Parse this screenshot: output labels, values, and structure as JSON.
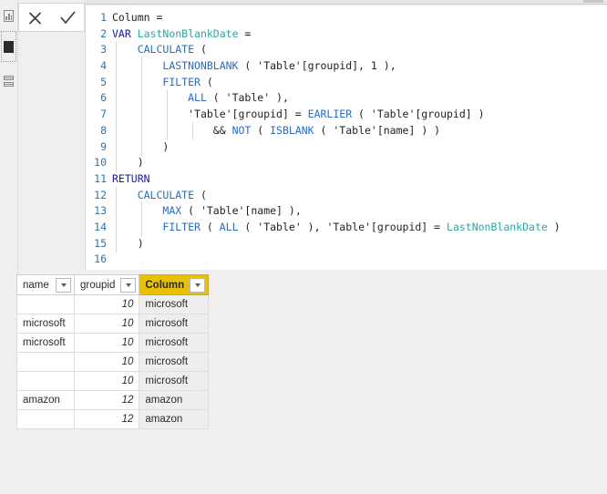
{
  "view_rail": {
    "items": [
      {
        "name": "report-view",
        "icon": "report-view-icon",
        "selected": false
      },
      {
        "name": "data-view",
        "icon": "data-view-icon",
        "selected": true
      },
      {
        "name": "model-view",
        "icon": "model-view-icon",
        "selected": false
      }
    ]
  },
  "formula_actions": {
    "cancel_label": "✕",
    "cancel_icon": "close-x-icon",
    "commit_label": "✓",
    "commit_icon": "checkmark-icon"
  },
  "editor": {
    "measure_name": "Column",
    "lines": [
      {
        "n": "1",
        "tokens": [
          {
            "t": "Column",
            "c": "ref"
          },
          {
            "t": " = ",
            "c": "op"
          }
        ],
        "guides": 0
      },
      {
        "n": "2",
        "tokens": [
          {
            "t": "VAR",
            "c": "kw"
          },
          {
            "t": " ",
            "c": "op"
          },
          {
            "t": "LastNonBlankDate",
            "c": "var"
          },
          {
            "t": " =",
            "c": "op"
          }
        ],
        "guides": 0
      },
      {
        "n": "3",
        "tokens": [
          {
            "t": "    ",
            "c": "op"
          },
          {
            "t": "CALCULATE",
            "c": "fn"
          },
          {
            "t": " (",
            "c": "op"
          }
        ],
        "guides": 1
      },
      {
        "n": "4",
        "tokens": [
          {
            "t": "        ",
            "c": "op"
          },
          {
            "t": "LASTNONBLANK",
            "c": "fn"
          },
          {
            "t": " ( ",
            "c": "op"
          },
          {
            "t": "'Table'[groupid]",
            "c": "ref"
          },
          {
            "t": ", ",
            "c": "op"
          },
          {
            "t": "1",
            "c": "num"
          },
          {
            "t": " ),",
            "c": "op"
          }
        ],
        "guides": 2
      },
      {
        "n": "5",
        "tokens": [
          {
            "t": "        ",
            "c": "op"
          },
          {
            "t": "FILTER",
            "c": "fn"
          },
          {
            "t": " (",
            "c": "op"
          }
        ],
        "guides": 2
      },
      {
        "n": "6",
        "tokens": [
          {
            "t": "            ",
            "c": "op"
          },
          {
            "t": "ALL",
            "c": "fn"
          },
          {
            "t": " ( ",
            "c": "op"
          },
          {
            "t": "'Table'",
            "c": "ref"
          },
          {
            "t": " ),",
            "c": "op"
          }
        ],
        "guides": 3
      },
      {
        "n": "7",
        "tokens": [
          {
            "t": "            ",
            "c": "op"
          },
          {
            "t": "'Table'[groupid]",
            "c": "ref"
          },
          {
            "t": " = ",
            "c": "op"
          },
          {
            "t": "EARLIER",
            "c": "fn"
          },
          {
            "t": " ( ",
            "c": "op"
          },
          {
            "t": "'Table'[groupid]",
            "c": "ref"
          },
          {
            "t": " )",
            "c": "op"
          }
        ],
        "guides": 3
      },
      {
        "n": "8",
        "tokens": [
          {
            "t": "                ",
            "c": "op"
          },
          {
            "t": "&& ",
            "c": "op"
          },
          {
            "t": "NOT",
            "c": "fn"
          },
          {
            "t": " ( ",
            "c": "op"
          },
          {
            "t": "ISBLANK",
            "c": "fn"
          },
          {
            "t": " ( ",
            "c": "op"
          },
          {
            "t": "'Table'[name]",
            "c": "ref"
          },
          {
            "t": " ) )",
            "c": "op"
          }
        ],
        "guides": 4
      },
      {
        "n": "9",
        "tokens": [
          {
            "t": "        )",
            "c": "op"
          }
        ],
        "guides": 2
      },
      {
        "n": "10",
        "tokens": [
          {
            "t": "    )",
            "c": "op"
          }
        ],
        "guides": 1
      },
      {
        "n": "11",
        "tokens": [
          {
            "t": "RETURN",
            "c": "kw"
          }
        ],
        "guides": 0
      },
      {
        "n": "12",
        "tokens": [
          {
            "t": "    ",
            "c": "op"
          },
          {
            "t": "CALCULATE",
            "c": "fn"
          },
          {
            "t": " (",
            "c": "op"
          }
        ],
        "guides": 1
      },
      {
        "n": "13",
        "tokens": [
          {
            "t": "        ",
            "c": "op"
          },
          {
            "t": "MAX",
            "c": "fn"
          },
          {
            "t": " ( ",
            "c": "op"
          },
          {
            "t": "'Table'[name]",
            "c": "ref"
          },
          {
            "t": " ),",
            "c": "op"
          }
        ],
        "guides": 2
      },
      {
        "n": "14",
        "tokens": [
          {
            "t": "        ",
            "c": "op"
          },
          {
            "t": "FILTER",
            "c": "fn"
          },
          {
            "t": " ( ",
            "c": "op"
          },
          {
            "t": "ALL",
            "c": "fn"
          },
          {
            "t": " ( ",
            "c": "op"
          },
          {
            "t": "'Table'",
            "c": "ref"
          },
          {
            "t": " ), ",
            "c": "op"
          },
          {
            "t": "'Table'[groupid]",
            "c": "ref"
          },
          {
            "t": " = ",
            "c": "op"
          },
          {
            "t": "LastNonBlankDate",
            "c": "var"
          },
          {
            "t": " )",
            "c": "op"
          }
        ],
        "guides": 2
      },
      {
        "n": "15",
        "tokens": [
          {
            "t": "    )",
            "c": "op"
          }
        ],
        "guides": 1
      },
      {
        "n": "16",
        "tokens": [
          {
            "t": "",
            "c": "op"
          }
        ],
        "guides": 0
      }
    ]
  },
  "grid": {
    "columns": [
      {
        "key": "name",
        "label": "name",
        "selected": false,
        "filter_icon": "filter-caret-icon"
      },
      {
        "key": "groupid",
        "label": "groupid",
        "selected": false,
        "filter_icon": "filter-caret-icon"
      },
      {
        "key": "column",
        "label": "Column",
        "selected": true,
        "filter_icon": "filter-caret-icon"
      }
    ],
    "rows": [
      {
        "name": "",
        "groupid": "10",
        "column": "microsoft"
      },
      {
        "name": "microsoft",
        "groupid": "10",
        "column": "microsoft"
      },
      {
        "name": "microsoft",
        "groupid": "10",
        "column": "microsoft"
      },
      {
        "name": "",
        "groupid": "10",
        "column": "microsoft"
      },
      {
        "name": "",
        "groupid": "10",
        "column": "microsoft"
      },
      {
        "name": "amazon",
        "groupid": "12",
        "column": "amazon"
      },
      {
        "name": "",
        "groupid": "12",
        "column": "amazon"
      }
    ]
  },
  "colors": {
    "selected_column_header": "#e8c107",
    "selected_column_cell": "#eeeeee",
    "keyword": "#1a1a9e",
    "function": "#2a6bc4",
    "variable": "#2ba7a0",
    "line_number": "#2e75a8",
    "app_background": "#f0efee"
  }
}
